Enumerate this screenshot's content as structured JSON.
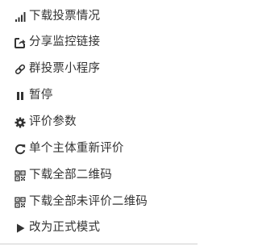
{
  "menu": {
    "items": [
      {
        "label": "下载投票情况",
        "icon": "signal-bars-icon"
      },
      {
        "label": "分享监控链接",
        "icon": "share-icon"
      },
      {
        "label": "群投票小程序",
        "icon": "link-icon"
      },
      {
        "label": "暂停",
        "icon": "pause-icon"
      },
      {
        "label": "评价参数",
        "icon": "gear-icon"
      },
      {
        "label": "单个主体重新评价",
        "icon": "refresh-icon"
      },
      {
        "label": "下载全部二维码",
        "icon": "qrcode-icon"
      },
      {
        "label": "下载全部未评价二维码",
        "icon": "qrcode-icon"
      },
      {
        "label": "改为正式模式",
        "icon": "play-icon"
      }
    ]
  },
  "colors": {
    "text": "#333333",
    "icon": "#333333",
    "divider": "#cfcfcf"
  }
}
